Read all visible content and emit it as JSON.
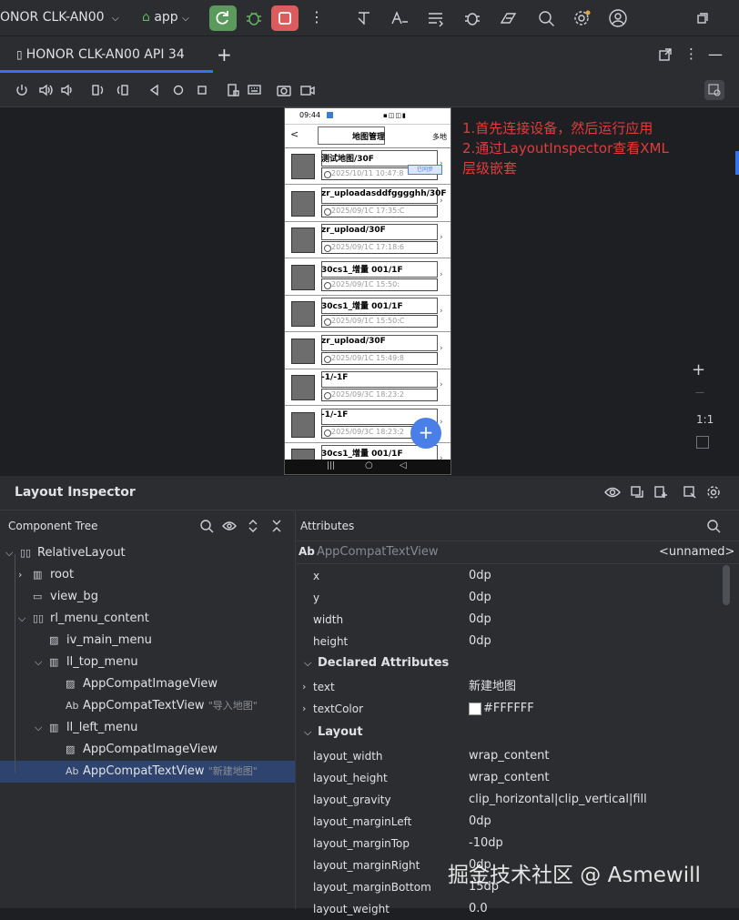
{
  "toolbar": {
    "project": "ONOR CLK-AN00",
    "run_config": "app",
    "more": "⋮"
  },
  "device_tab": {
    "label": "HONOR CLK-AN00 API 34",
    "add": "+"
  },
  "annotation": {
    "line1": "1.首先连接设备，然后运行应用",
    "line2": "2.通过LayoutInspector查看XML",
    "line3": "层级嵌套"
  },
  "phone": {
    "status_time": "09:44",
    "header_title": "地图管理",
    "header_right": "多地",
    "badge": "已同步",
    "rows": [
      {
        "title": "测试地图/30F",
        "date": "2025/10/11 10:47:8"
      },
      {
        "title": "zr_uploadasddfgggghh/30F",
        "date": "2025/09/1C 17:35:C"
      },
      {
        "title": "zr_upload/30F",
        "date": "2025/09/1C 17:18:6"
      },
      {
        "title": "30cs1_增量 001/1F",
        "date": "2025/09/1C 15:50:"
      },
      {
        "title": "30cs1_增量 001/1F",
        "date": "2025/09/1C 15:50:C"
      },
      {
        "title": "zr_upload/30F",
        "date": "2025/09/1C 15:49:8"
      },
      {
        "title": "-1/-1F",
        "date": "2025/09/3C 18:23:2"
      },
      {
        "title": "-1/-1F",
        "date": "2025/09/3C 18:23:2"
      },
      {
        "title": "30cs1_增量 001/1F",
        "date": ""
      }
    ]
  },
  "zoom": {
    "plus": "+",
    "minus": "—",
    "ratio": "1:1"
  },
  "inspector": {
    "title": "Layout Inspector",
    "tree_title": "Component Tree",
    "attrs_title": "Attributes",
    "selected_type": "AppCompatTextView",
    "unnamed": "<unnamed>",
    "tree": [
      {
        "label": "RelativeLayout",
        "hint": ""
      },
      {
        "label": "root",
        "hint": ""
      },
      {
        "label": "view_bg",
        "hint": ""
      },
      {
        "label": "rl_menu_content",
        "hint": ""
      },
      {
        "label": "iv_main_menu",
        "hint": ""
      },
      {
        "label": "ll_top_menu",
        "hint": ""
      },
      {
        "label": "AppCompatImageView",
        "hint": ""
      },
      {
        "label": "AppCompatTextView",
        "hint": "\"导入地图\""
      },
      {
        "label": "ll_left_menu",
        "hint": ""
      },
      {
        "label": "AppCompatImageView",
        "hint": ""
      },
      {
        "label": "AppCompatTextView",
        "hint": "\"新建地图\""
      }
    ],
    "ab_prefix": "Ab",
    "basic_attrs": [
      {
        "name": "x",
        "value": "0dp"
      },
      {
        "name": "y",
        "value": "0dp"
      },
      {
        "name": "width",
        "value": "0dp"
      },
      {
        "name": "height",
        "value": "0dp"
      }
    ],
    "declared_title": "Declared Attributes",
    "declared": [
      {
        "name": "text",
        "value": "新建地图"
      },
      {
        "name": "textColor",
        "value": "#FFFFFF"
      }
    ],
    "layout_title": "Layout",
    "layout": [
      {
        "name": "layout_width",
        "value": "wrap_content"
      },
      {
        "name": "layout_height",
        "value": "wrap_content"
      },
      {
        "name": "layout_gravity",
        "value": "clip_horizontal|clip_vertical|fill"
      },
      {
        "name": "layout_marginLeft",
        "value": "0dp"
      },
      {
        "name": "layout_marginTop",
        "value": "-10dp"
      },
      {
        "name": "layout_marginRight",
        "value": "0dp"
      },
      {
        "name": "layout_marginBottom",
        "value": "15dp"
      },
      {
        "name": "layout_weight",
        "value": "0.0"
      }
    ]
  },
  "watermark": "掘金技术社区 @ Asmewill",
  "colors": {
    "accent": "#3574f0",
    "run": "#5b9a5c",
    "stop": "#db5c5c",
    "annotation": "#e03c3c",
    "fab": "#4a7fe8"
  }
}
